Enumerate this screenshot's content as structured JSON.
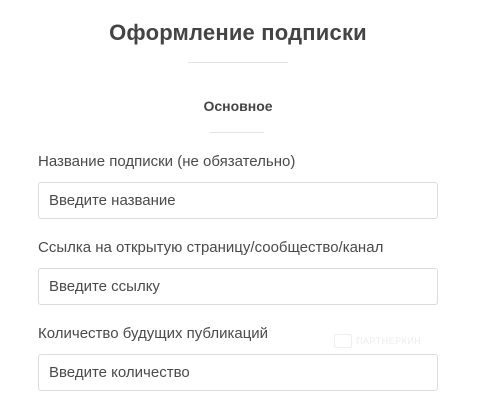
{
  "header": {
    "title": "Оформление подписки"
  },
  "section": {
    "title": "Основное"
  },
  "form": {
    "subscription_name": {
      "label": "Название подписки (не обязательно)",
      "placeholder": "Введите название",
      "value": ""
    },
    "link": {
      "label": "Ссылка на открытую страницу/сообщество/канал",
      "placeholder": "Введите ссылку",
      "value": ""
    },
    "publication_count": {
      "label": "Количество будущих публикаций",
      "placeholder": "Введите количество",
      "value": ""
    }
  },
  "watermark": {
    "icon": "partner-logo-icon",
    "text": "ПАРТНЕРКИН"
  },
  "colors": {
    "text": "#444444",
    "border": "#dcdcdc",
    "divider": "#e2e2e2",
    "background": "#ffffff"
  }
}
